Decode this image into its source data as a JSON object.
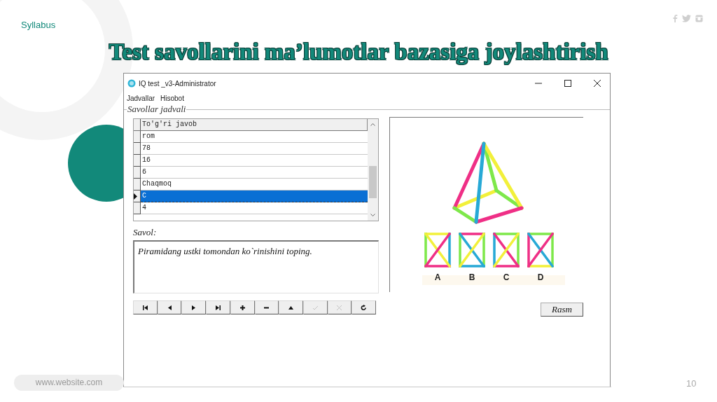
{
  "slide": {
    "section": "Syllabus",
    "title": "Test savollarini ma’lumotlar bazasiga joylashtirish",
    "footer_url": "www.website.com",
    "page_number": "10"
  },
  "window": {
    "title": "IQ test _v3-Administrator",
    "menu": [
      "Jadvallar",
      "Hisobot"
    ],
    "group_title": "Savollar jadvali",
    "table": {
      "columns": [
        "To'g'ri javob"
      ],
      "rows": [
        {
          "cells": [
            "rom"
          ],
          "selected": false
        },
        {
          "cells": [
            "78"
          ],
          "selected": false
        },
        {
          "cells": [
            "16"
          ],
          "selected": false
        },
        {
          "cells": [
            "6"
          ],
          "selected": false
        },
        {
          "cells": [
            "Chaqmoq"
          ],
          "selected": false
        },
        {
          "cells": [
            "C"
          ],
          "selected": true
        },
        {
          "cells": [
            "4"
          ],
          "selected": false
        }
      ]
    },
    "question_label": "Savol:",
    "question_text": "Piramidang ustki tomondan ko`rinishini toping.",
    "navigator": [
      {
        "kind": "first",
        "disabled": false
      },
      {
        "kind": "prior",
        "disabled": false
      },
      {
        "kind": "next",
        "disabled": false
      },
      {
        "kind": "last",
        "disabled": false
      },
      {
        "kind": "insert",
        "disabled": false
      },
      {
        "kind": "delete",
        "disabled": false
      },
      {
        "kind": "edit",
        "disabled": false
      },
      {
        "kind": "post",
        "disabled": true
      },
      {
        "kind": "cancel",
        "disabled": true
      },
      {
        "kind": "refresh",
        "disabled": false
      }
    ],
    "image_labels": [
      "A",
      "B",
      "C",
      "D"
    ],
    "image_button": "Rasm"
  }
}
